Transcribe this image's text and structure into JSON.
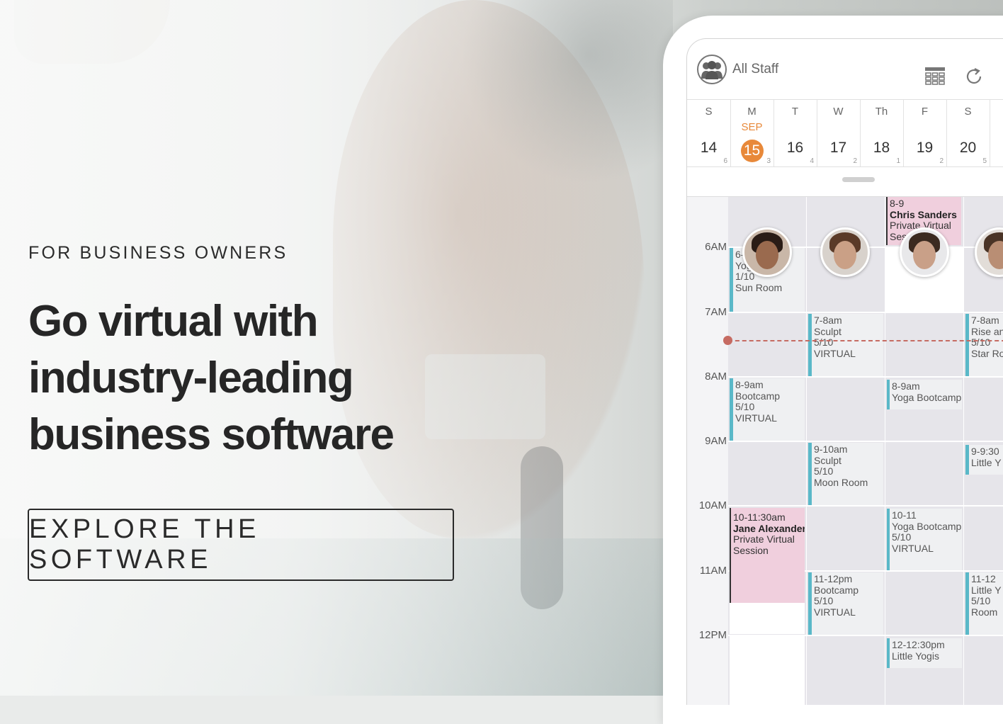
{
  "hero": {
    "eyebrow": "FOR BUSINESS OWNERS",
    "headline": [
      "Go virtual with",
      "industry-leading",
      "business software"
    ],
    "cta_label": "EXPLORE THE SOFTWARE"
  },
  "app": {
    "staff_label": "All Staff",
    "icons": {
      "staff": "group-icon",
      "grid": "grid-view-icon",
      "refresh": "refresh-icon"
    },
    "accent": "#e8893a",
    "days": [
      {
        "dn": "S",
        "num": "14",
        "cnt": "6",
        "month": ""
      },
      {
        "dn": "M",
        "num": "15",
        "cnt": "3",
        "month": "SEP"
      },
      {
        "dn": "T",
        "num": "16",
        "cnt": "4",
        "month": ""
      },
      {
        "dn": "W",
        "num": "17",
        "cnt": "2",
        "month": ""
      },
      {
        "dn": "Th",
        "num": "18",
        "cnt": "1",
        "month": ""
      },
      {
        "dn": "F",
        "num": "19",
        "cnt": "2",
        "month": ""
      },
      {
        "dn": "S",
        "num": "20",
        "cnt": "5",
        "month": ""
      }
    ],
    "times": [
      "6AM",
      "7AM",
      "8AM",
      "9AM",
      "10AM",
      "11AM",
      "12PM"
    ],
    "events": {
      "c1_a": [
        "6-",
        "Yog",
        "1/10",
        "Sun Room"
      ],
      "c1_b": [
        "8-9am",
        "Bootcamp",
        "5/10",
        "VIRTUAL"
      ],
      "c1_c": [
        "10-11:30am",
        "Jane Alexander",
        "Private Virtual",
        "Session"
      ],
      "c2_a": [
        "7-8am",
        "Sculpt",
        "5/10",
        "VIRTUAL"
      ],
      "c2_b": [
        "9-10am",
        "Sculpt",
        "5/10",
        "Moon Room"
      ],
      "c2_c": [
        "11-12pm",
        "Bootcamp",
        "5/10",
        "VIRTUAL"
      ],
      "c3_a": [
        "8-9",
        "Chris Sanders",
        "Private Virtual",
        "Ses"
      ],
      "c3_b": [
        "8-9am",
        "Yoga Bootcamp"
      ],
      "c3_c": [
        "10-11",
        "Yoga Bootcamp",
        "5/10",
        "VIRTUAL"
      ],
      "c3_d": [
        "12-12:30pm",
        "Little Yogis"
      ],
      "c4_a": [
        "7-8am",
        "Rise an",
        "5/10",
        "Star Ro"
      ],
      "c4_b": [
        "9-9:30",
        "Little Y"
      ],
      "c4_c": [
        "11-12",
        "Little Y",
        "5/10",
        "Room"
      ]
    },
    "colors": {
      "now_line": "#c66b62",
      "event_accent": "#5ab8c8",
      "private_session": "#f0cfdd"
    }
  }
}
